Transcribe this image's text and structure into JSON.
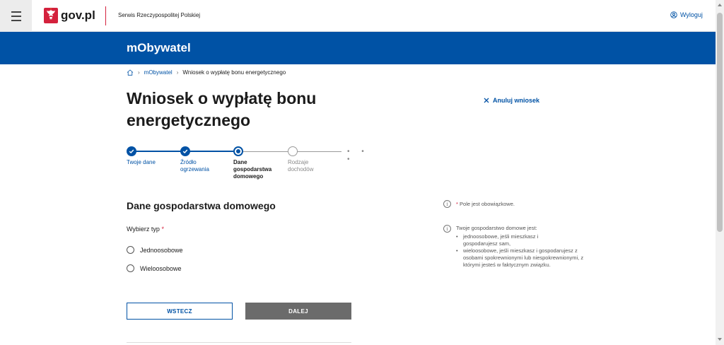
{
  "header": {
    "logo_text": "gov.pl",
    "service_name": "Serwis Rzeczypospolitej Polskiej",
    "logout_label": "Wyloguj"
  },
  "band": {
    "title": "mObywatel"
  },
  "breadcrumb": {
    "items": [
      "mObywatel",
      "Wniosek o wypłatę bonu energetycznego"
    ]
  },
  "page": {
    "title": "Wniosek o wypłatę bonu energetycznego",
    "cancel_label": "Anuluj wniosek"
  },
  "stepper": {
    "steps": [
      {
        "label": "Twoje dane",
        "state": "done"
      },
      {
        "label": "Źródło ogrzewania",
        "state": "done"
      },
      {
        "label": "Dane gospodarstwa domowego",
        "state": "active"
      },
      {
        "label": "Rodzaje dochodów",
        "state": "todo"
      }
    ],
    "more": "• • •"
  },
  "form": {
    "section_title": "Dane gospodarstwa domowego",
    "field_label": "Wybierz typ",
    "required_mark": "*",
    "options": [
      "Jednoosobowe",
      "Wieloosobowe"
    ]
  },
  "notes": {
    "required_text": "Pole jest obowiązkowe.",
    "required_mark": "*",
    "household_intro": "Twoje gospodarstwo domowe jest:",
    "household_items": [
      "jednoosobowe, jeśli mieszkasz i gospodarujesz sam,",
      "wieloosobowe, jeśli mieszkasz i gospodarujesz z osobami spokrewnionymi lub niespokrewnionymi, z którymi jesteś w faktycznym związku."
    ]
  },
  "buttons": {
    "back": "WSTECZ",
    "next": "DALEJ"
  },
  "colors": {
    "brand_blue": "#0052a5",
    "accent_red": "#d4213d",
    "disabled_gray": "#6b6b6b"
  }
}
